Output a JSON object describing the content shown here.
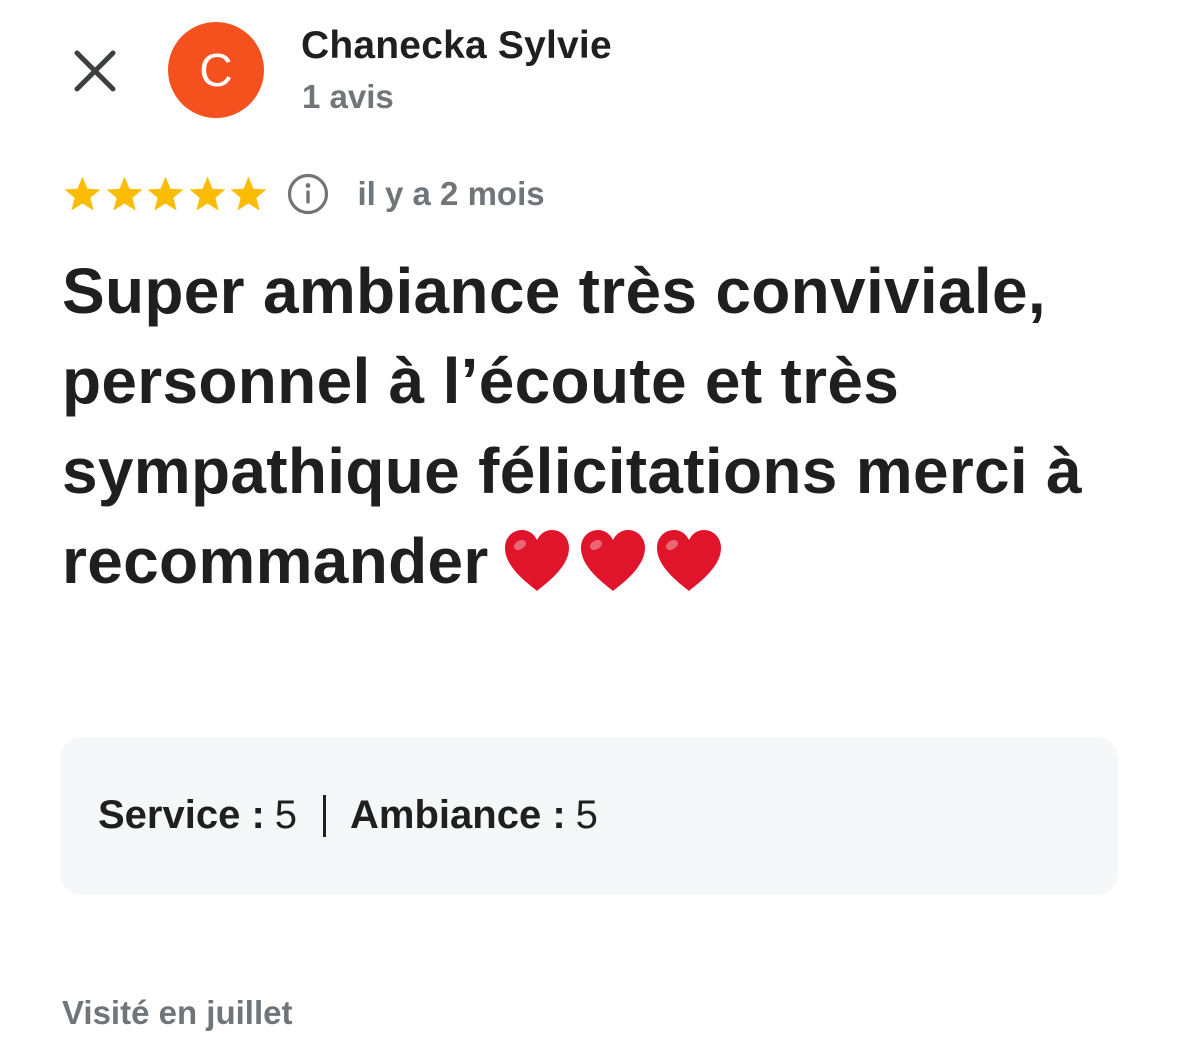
{
  "header": {
    "close_icon": "close-icon",
    "avatar_initial": "C",
    "avatar_color": "#f4511e",
    "reviewer_name": "Chanecka Sylvie",
    "review_count": "1 avis"
  },
  "review": {
    "rating": 5,
    "rating_max": 5,
    "star_color": "#fbbc04",
    "info_icon": "info-icon",
    "time_ago": "il y a 2 mois",
    "text": "Super ambiance très conviviale, personnel à l’écoute et très sympathique félicitations merci à recommander",
    "emoji_icon": "heart-emoji-icon",
    "emoji_count": 3,
    "emoji_color": "#e0142a"
  },
  "attributes": {
    "service_label": "Service :",
    "service_value": "5",
    "ambiance_label": "Ambiance :",
    "ambiance_value": "5"
  },
  "footer": {
    "visited": "Visité en juillet"
  }
}
